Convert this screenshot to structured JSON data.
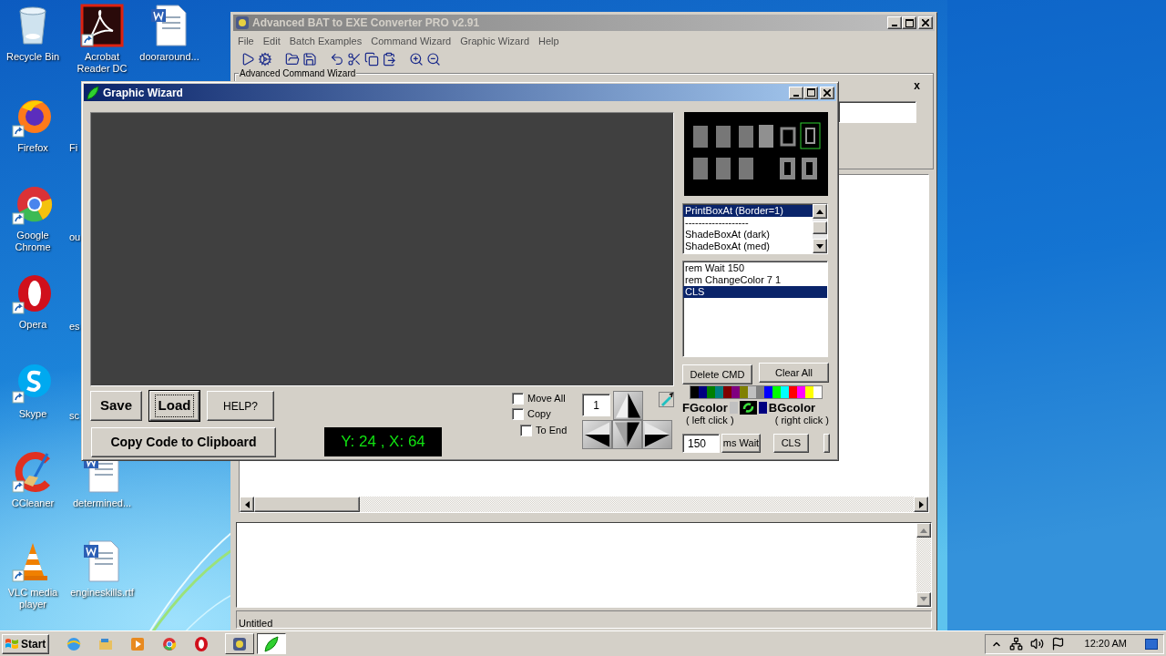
{
  "desktop": {
    "icons": [
      {
        "kind": "recycle",
        "label": "Recycle Bin"
      },
      {
        "kind": "acrobat",
        "label": "Acrobat Reader DC"
      },
      {
        "kind": "word",
        "label": "dooraround..."
      },
      {
        "kind": "firefox",
        "label": "Firefox"
      },
      {
        "kind": "chrome",
        "label": "Google Chrome"
      },
      {
        "kind": "opera",
        "label": "Opera"
      },
      {
        "kind": "skype",
        "label": "Skype"
      },
      {
        "kind": "ccleaner",
        "label": "CCleaner"
      },
      {
        "kind": "word",
        "label": "determined..."
      },
      {
        "kind": "vlc",
        "label": "VLC media player"
      },
      {
        "kind": "word",
        "label": "engineskills.rtf"
      }
    ],
    "cut_labels": [
      "Fi",
      "ou",
      "es",
      "sc"
    ]
  },
  "main_window": {
    "title": "Advanced BAT to EXE Converter PRO v2.91",
    "active": false,
    "menu": [
      "File",
      "Edit",
      "Batch Examples",
      "Command Wizard",
      "Graphic Wizard",
      "Help"
    ],
    "panel_label": "Advanced Command Wizard",
    "panel_close": "x",
    "status": "Untitled"
  },
  "graphic_wizard": {
    "title": "Graphic Wizard",
    "commands": [
      {
        "label": "PrintBoxAt (Border=1)",
        "selected": true
      },
      {
        "label": "-------------------",
        "selected": false
      },
      {
        "label": "ShadeBoxAt (dark)",
        "selected": false
      },
      {
        "label": "ShadeBoxAt (med)",
        "selected": false
      }
    ],
    "script": [
      {
        "label": "rem Wait 150",
        "selected": false
      },
      {
        "label": "rem ChangeColor 7 1",
        "selected": false
      },
      {
        "label": "CLS",
        "selected": true
      }
    ],
    "delete_button": "Delete CMD",
    "clear_button": "Clear All",
    "palette": [
      {
        "color": "#000000"
      },
      {
        "color": "#000080"
      },
      {
        "color": "#008000"
      },
      {
        "color": "#008080"
      },
      {
        "color": "#800000"
      },
      {
        "color": "#800080"
      },
      {
        "color": "#808000"
      },
      {
        "color": "#c0c0c0"
      },
      {
        "color": "#808080"
      },
      {
        "color": "#0000ff"
      },
      {
        "color": "#00ff00"
      },
      {
        "color": "#00ffff"
      },
      {
        "color": "#ff0000"
      },
      {
        "color": "#ff00ff"
      },
      {
        "color": "#ffff00"
      },
      {
        "color": "#ffffff"
      }
    ],
    "fg_label": "FGcolor",
    "fg_hint": "( left click )",
    "fg_swatch": {
      "color": "#c0c0c0"
    },
    "bg_label": "BGcolor",
    "bg_hint": "( right click )",
    "bg_swatch": {
      "color": "#000080"
    },
    "wait_value": "150",
    "wait_button": "ms Wait",
    "cls_button": "CLS",
    "save_button": {
      "label": "Save",
      "focused": false
    },
    "load_button": {
      "label": "Load",
      "focused": true
    },
    "help_button": {
      "label": "HELP?",
      "focused": false
    },
    "copy_button": {
      "label": "Copy Code to Clipboard",
      "focused": false
    },
    "coordinates": "Y: 24 , X: 64",
    "options": [
      {
        "label": "Move All",
        "checked": false
      },
      {
        "label": "Copy",
        "checked": false
      },
      {
        "label": "To End",
        "checked": false
      }
    ],
    "step_value": "1"
  },
  "taskbar": {
    "start": "Start",
    "apps": [
      {
        "kind": "converter",
        "selected": false
      },
      {
        "kind": "wizard",
        "selected": true
      }
    ],
    "clock": "12:20 AM"
  }
}
